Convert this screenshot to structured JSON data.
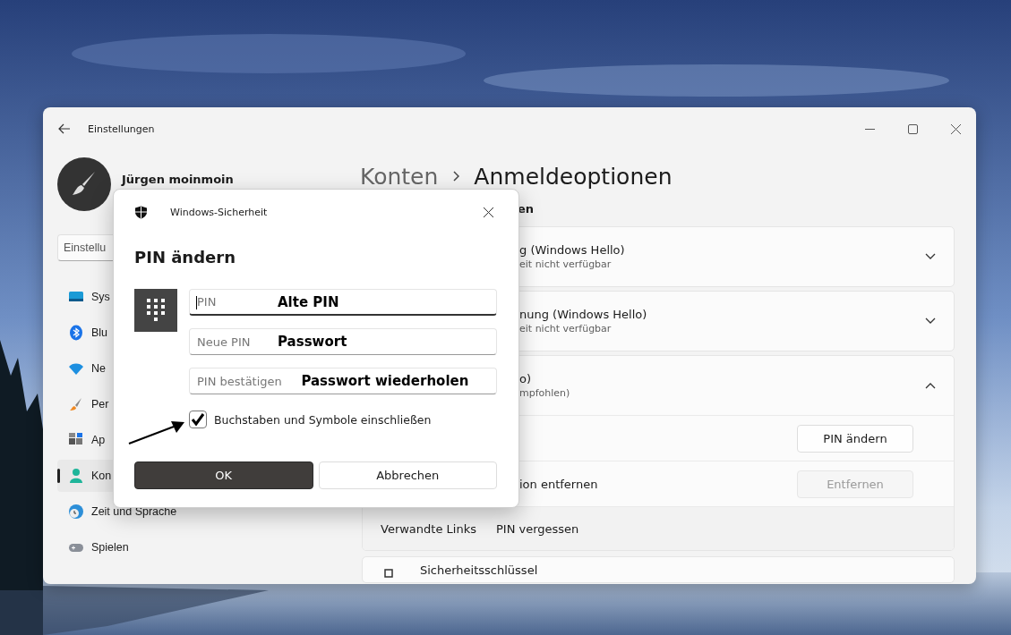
{
  "window": {
    "title": "Einstellungen",
    "user_name": "Jürgen moinmoin",
    "search": {
      "value": "Einstellu"
    },
    "sidebar": {
      "items": [
        {
          "label": "Sys",
          "selected": false
        },
        {
          "label": "Blu",
          "selected": false
        },
        {
          "label": "Ne",
          "selected": false
        },
        {
          "label": "Per",
          "selected": false
        },
        {
          "label": "Ap",
          "selected": false
        },
        {
          "label": "Kon",
          "selected": true
        },
        {
          "label": "Zeit und Sprache",
          "selected": false
        },
        {
          "label": "Spielen",
          "selected": false
        }
      ]
    }
  },
  "breadcrumb": {
    "parent": "Konten",
    "current": "Anmeldeoptionen"
  },
  "section_heading": "en",
  "cards": [
    {
      "title": "g (Windows Hello)",
      "subtitle": "eit nicht verfügbar",
      "expanded": false
    },
    {
      "title": "nung (Windows Hello)",
      "subtitle": "eit nicht verfügbar",
      "expanded": false
    },
    {
      "title": "o)",
      "subtitle": "mpfohlen)",
      "expanded": true,
      "rows": [
        {
          "button": {
            "label": "PIN ändern",
            "disabled": false
          }
        },
        {
          "label": "ion entfernen",
          "button": {
            "label": "Entfernen",
            "disabled": true
          }
        }
      ],
      "related": {
        "label": "Verwandte Links",
        "link": "PIN vergessen"
      }
    },
    {
      "title": "Sicherheitsschlüssel"
    }
  ],
  "dialog": {
    "title": "Windows-Sicherheit",
    "heading": "PIN ändern",
    "fields": [
      {
        "placeholder": "PIN",
        "annotation": "Alte PIN",
        "focused": true
      },
      {
        "placeholder": "Neue PIN",
        "annotation": "Passwort",
        "focused": false
      },
      {
        "placeholder": "PIN bestätigen",
        "annotation": "Passwort wiederholen",
        "focused": false
      }
    ],
    "checkbox": {
      "label": "Buchstaben und Symbole einschließen",
      "checked": true
    },
    "buttons": [
      {
        "label": "OK",
        "kind": "primary"
      },
      {
        "label": "Abbrechen",
        "kind": "secondary"
      }
    ]
  }
}
